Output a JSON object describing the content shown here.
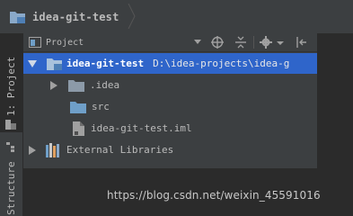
{
  "breadcrumb": {
    "project_name": "idea-git-test"
  },
  "tool_strip": {
    "project_tab": "1: Project",
    "structure_tab": "Structure"
  },
  "panel": {
    "view_selector": "Project",
    "tree": [
      {
        "label": "idea-git-test",
        "path": "D:\\idea-projects\\idea-g",
        "expanded": true,
        "selected": true
      },
      {
        "label": ".idea",
        "expanded": false
      },
      {
        "label": "src"
      },
      {
        "label": "idea-git-test.iml"
      },
      {
        "label": "External Libraries",
        "expanded": false
      }
    ]
  },
  "watermark": "https://blog.csdn.net/weixin_45591016",
  "colors": {
    "selection": "#2f65ca",
    "panel_bg": "#3c3f41",
    "editor_bg": "#2b2b2b",
    "folder_blue": "#6f9fc8"
  }
}
